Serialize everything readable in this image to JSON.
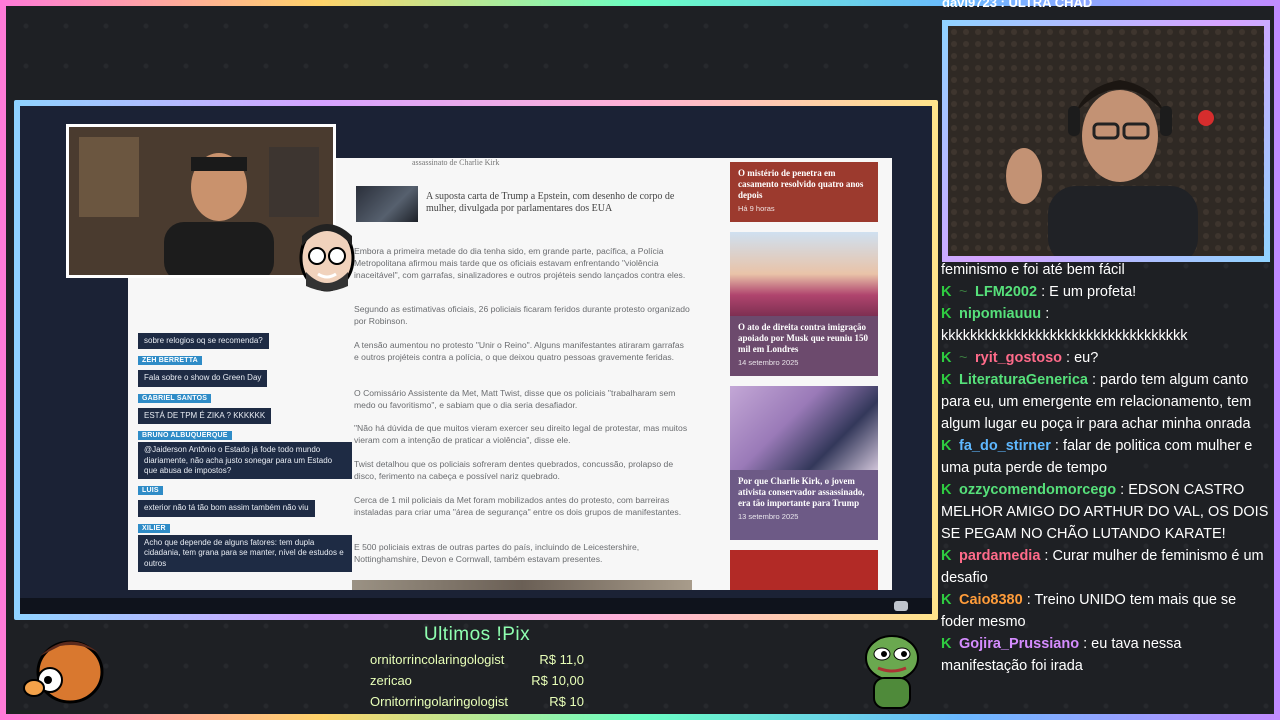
{
  "article": {
    "top_cut_text": "assassinato de Charlie Kirk",
    "related_title": "A suposta carta de Trump a Epstein, com desenho de corpo de mulher, divulgada por parlamentares dos EUA",
    "paragraphs": [
      "Embora a primeira metade do dia tenha sido, em grande parte, pacífica, a Polícia Metropolitana afirmou mais tarde que os oficiais estavam enfrentando \"violência inaceitável\", com garrafas, sinalizadores e outros projéteis sendo lançados contra eles.",
      "Segundo as estimativas oficiais, 26 policiais ficaram feridos durante protesto organizado por Robinson.",
      "A tensão aumentou no protesto \"Unir o Reino\". Alguns manifestantes atiraram garrafas e outros projéteis contra a polícia, o que deixou quatro pessoas gravemente feridas.",
      "O Comissário Assistente da Met, Matt Twist, disse que os policiais \"trabalharam sem medo ou favoritismo\", e sabiam que o dia seria desafiador.",
      "\"Não há dúvida de que muitos vieram exercer seu direito legal de protestar, mas muitos vieram com a intenção de praticar a violência\", disse ele.",
      "Twist detalhou que os policiais sofreram dentes quebrados, concussão, prolapso de disco, ferimento na cabeça e possível nariz quebrado.",
      "Cerca de 1 mil policiais da Met foram mobilizados antes do protesto, com barreiras instaladas para criar uma \"área de segurança\" entre os dois grupos de manifestantes.",
      "E 500 policiais extras de outras partes do país, incluindo de Leicestershire, Nottinghamshire, Devon e Cornwall, também estavam presentes."
    ],
    "side_cards": [
      {
        "title": "O mistério de penetra em casamento resolvido quatro anos depois",
        "date": "Há 9 horas",
        "color": "#9c3a2e"
      },
      {
        "title": "O ato de direita contra imigração apoiado por Musk que reuniu 150 mil em Londres",
        "date": "14 setembro 2025",
        "color": "#6c4a6d"
      },
      {
        "title": "Por que Charlie Kirk, o jovem ativista conservador assassinado, era tão importante para Trump",
        "date": "13 setembro 2025",
        "color": "#6d5a86"
      }
    ]
  },
  "overlay_chat": [
    {
      "name": "",
      "msg": "sobre relogios oq se recomenda?"
    },
    {
      "name": "ZEH BERRETTA",
      "msg": "Fala sobre o show do Green Day"
    },
    {
      "name": "GABRIEL SANTOS",
      "msg": "ESTÁ DE TPM É ZIKA ? KKKKKK"
    },
    {
      "name": "BRUNO ALBUQUERQUE",
      "msg": "@Jaiderson Antônio o Estado já fode todo mundo diariamente, não acha justo sonegar para um Estado que abusa de impostos?"
    },
    {
      "name": "LUIS",
      "msg": "exterior não tá tão bom assim também não viu"
    },
    {
      "name": "XILIER",
      "msg": "Acho que depende de alguns fatores: tem dupla cidadania, tem grana para se manter, nível de estudos e outros"
    }
  ],
  "chat": {
    "top_cut": "davi9723 : ULTRA CHAD",
    "first_line": "feminismo e foi até bem fácil",
    "messages": [
      {
        "user": "LFM2002",
        "color": "#56e07a",
        "text": "E um profeta!"
      },
      {
        "user": "nipomiauuu",
        "color": "#56e07a",
        "text": "kkkkkkkkkkkkkkkkkkkkkkkkkkkkkkkkkk"
      },
      {
        "user": "ryit_gostoso",
        "color": "#ff6b8a",
        "text": "eu?"
      },
      {
        "user": "LiteraturaGenerica",
        "color": "#56e07a",
        "text": "pardo tem algum canto para eu, um emergente em relacionamento, tem algum lugar eu poça ir para achar minha onrada"
      },
      {
        "user": "fa_do_stirner",
        "color": "#5fb8ff",
        "text": "falar de politica com mulher e uma puta perde de tempo"
      },
      {
        "user": "ozzycomendomorcego",
        "color": "#56e07a",
        "text": "EDSON CASTRO MELHOR AMIGO DO ARTHUR DO VAL, OS DOIS SE PEGAM NO CHÃO LUTANDO KARATE!"
      },
      {
        "user": "pardamedia",
        "color": "#ff6b8a",
        "text": "Curar mulher de feminismo é um desafio"
      },
      {
        "user": "Caio8380",
        "color": "#ff9c3a",
        "text": "Treino UNIDO tem mais que se foder mesmo"
      },
      {
        "user": "Gojira_Prussiano",
        "color": "#d58cff",
        "text": "eu tava nessa manifestação foi irada"
      }
    ]
  },
  "pix": {
    "title": "Ultimos !Pix",
    "rows": [
      {
        "name": "ornitorrincolaringologist",
        "amount": "R$ 11,0"
      },
      {
        "name": "zericao",
        "amount": "R$ 10,00"
      },
      {
        "name": "Ornitorringolaringologist",
        "amount": "R$ 10"
      }
    ]
  }
}
